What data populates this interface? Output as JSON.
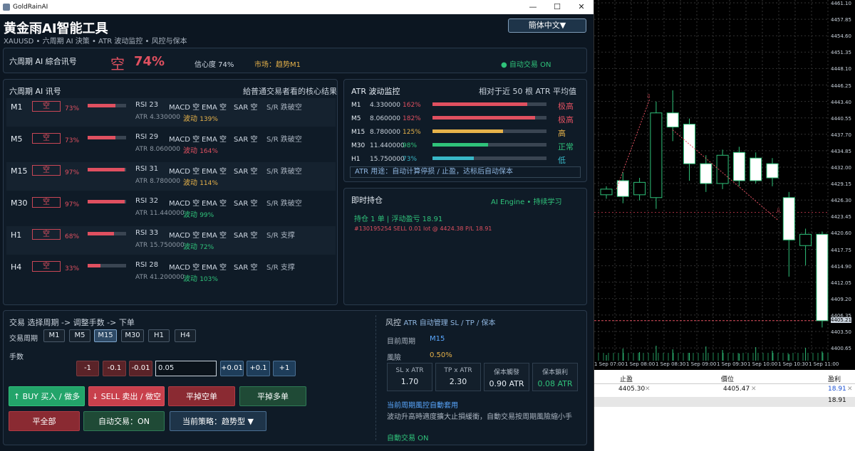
{
  "window": {
    "title": "GoldRainAI",
    "controls": [
      "—",
      "☐",
      "✕"
    ]
  },
  "app": {
    "title": "黄金雨AI智能工具",
    "subtitle": "XAUUSD • 六周期 AI 決策 • ATR 波动监控 • 风控与保本",
    "lang": "簡体中文▼"
  },
  "signal": {
    "label": "六周期 AI 綜合讯号",
    "direction": "空",
    "percent": "74%",
    "confidence": "信心度 74%",
    "market": "市场：趋势M1",
    "auto": "● 自动交易 ON"
  },
  "periods": {
    "title": "六周期 AI 讯号",
    "subtitle": "給普通交易者看的核心结果",
    "rows": [
      {
        "p": "M1",
        "d": "空",
        "pct": "73%",
        "fill": 0.73,
        "rsi": "RSI 23",
        "macd": "MACD 空",
        "ema": "EMA 空",
        "sar": "SAR 空",
        "sr": "S/R 跌破空",
        "atr": "ATR 4.330000",
        "vol": "波动",
        "volp": "139%",
        "volc": "#e6b24a"
      },
      {
        "p": "M5",
        "d": "空",
        "pct": "73%",
        "fill": 0.73,
        "rsi": "RSI 29",
        "macd": "MACD 空",
        "ema": "EMA 空",
        "sar": "SAR 空",
        "sr": "S/R 跌破空",
        "atr": "ATR 8.060000",
        "vol": "波动",
        "volp": "164%",
        "volc": "#e05060"
      },
      {
        "p": "M15",
        "d": "空",
        "pct": "97%",
        "fill": 0.97,
        "rsi": "RSI 31",
        "macd": "MACD 空",
        "ema": "EMA 空",
        "sar": "SAR 空",
        "sr": "S/R 跌破空",
        "atr": "ATR 8.780000",
        "vol": "波动",
        "volp": "114%",
        "volc": "#e6b24a"
      },
      {
        "p": "M30",
        "d": "空",
        "pct": "97%",
        "fill": 0.97,
        "rsi": "RSI 32",
        "macd": "MACD 空",
        "ema": "EMA 空",
        "sar": "SAR 空",
        "sr": "S/R 跌破空",
        "atr": "ATR 11.440000",
        "vol": "波动",
        "volp": "99%",
        "volc": "#2fc27a"
      },
      {
        "p": "H1",
        "d": "空",
        "pct": "68%",
        "fill": 0.68,
        "rsi": "RSI 33",
        "macd": "MACD 空",
        "ema": "EMA 空",
        "sar": "SAR 空",
        "sr": "S/R 支撑",
        "atr": "ATR 15.750000",
        "vol": "波动",
        "volp": "72%",
        "volc": "#2fc27a"
      },
      {
        "p": "H4",
        "d": "空",
        "pct": "33%",
        "fill": 0.33,
        "rsi": "RSI 28",
        "macd": "MACD 空",
        "ema": "EMA 空",
        "sar": "SAR 空",
        "sr": "S/R 支撑",
        "atr": "ATR 41.200000",
        "vol": "波动",
        "volp": "103%",
        "volc": "#2fc27a"
      }
    ]
  },
  "atr": {
    "title": "ATR 波动监控",
    "subtitle": "相对于近 50 根 ATR 平均值",
    "note": "ATR 用途：自动计算停损 / 止盈，达标后自动保本",
    "rows": [
      {
        "p": "M1",
        "v": "4.330000",
        "r": "162%",
        "fill": 0.83,
        "c": "#e05060",
        "lvl": "极高"
      },
      {
        "p": "M5",
        "v": "8.060000",
        "r": "182%",
        "fill": 0.9,
        "c": "#e05060",
        "lvl": "极高"
      },
      {
        "p": "M15",
        "v": "8.780000",
        "r": "125%",
        "fill": 0.62,
        "c": "#e6b24a",
        "lvl": "高"
      },
      {
        "p": "M30",
        "v": "11.440000",
        "r": "98%",
        "fill": 0.49,
        "c": "#2fc27a",
        "lvl": "正常"
      },
      {
        "p": "H1",
        "v": "15.750000",
        "r": "73%",
        "fill": 0.36,
        "c": "#39b8c8",
        "lvl": "低"
      }
    ]
  },
  "position": {
    "title": "即时持仓",
    "engine": "AI Engine • 持续学习",
    "summary": "持仓 1 单 | 浮动盈亏 18.91",
    "detail": "#130195254  SELL  0.01 lot  @ 4424.38  P/L 18.91"
  },
  "trade": {
    "title": "交易  选择周期 -> 调整手数 -> 下单",
    "period_label": "交易周期",
    "periods": [
      "M1",
      "M5",
      "M15",
      "M30",
      "H1",
      "H4"
    ],
    "active": "M15",
    "lots_label": "手数",
    "lot_btns_minus": [
      "-1",
      "-0.1",
      "-0.01"
    ],
    "lot_value": "0.05",
    "lot_btns_plus": [
      "+0.01",
      "+0.1",
      "+1"
    ],
    "buy": "↑ BUY 买入 / 做多",
    "sell": "↓ SELL 卖出 / 做空",
    "close_short": "平掉空单",
    "close_long": "平掉多单",
    "close_all": "平全部",
    "auto": "自动交易：ON",
    "strategy": "当前策略：趋势型 ▼"
  },
  "risk": {
    "title": "风控",
    "title_sub": "ATR 自动管理 SL / TP / 保本",
    "period_label": "目前周期",
    "period": "M15",
    "risk_label": "風險",
    "risk": "0.50%",
    "boxes": [
      {
        "l": "SL x ATR",
        "v": "1.70"
      },
      {
        "l": "TP x ATR",
        "v": "2.30"
      },
      {
        "l": "保本觸發",
        "v": "0.90 ATR"
      },
      {
        "l": "保本鎖利",
        "v": "0.08 ATR"
      }
    ],
    "applied": "当前周期風控自動套用",
    "desc": "波动升高時適度擴大止損緩衝，自動交易按周期風險縮小手",
    "auto": "自動交易 ON"
  },
  "chart_data": {
    "type": "candlestick",
    "price_ticks": [
      "4461.10",
      "4457.85",
      "4454.60",
      "4451.35",
      "4448.10",
      "4446.25",
      "4443.40",
      "4440.55",
      "4437.70",
      "4434.85",
      "4432.00",
      "4429.15",
      "4426.30",
      "4423.45",
      "4420.60",
      "4417.75",
      "4414.90",
      "4412.05",
      "4409.20",
      "4406.35",
      "4403.50",
      "4400.65"
    ],
    "current_price": "4405.21",
    "time_ticks": [
      "1 Sep 07:00",
      "1 Sep 08:00",
      "1 Sep 08:30",
      "1 Sep 09:00",
      "1 Sep 09:30",
      "1 Sep 10:00",
      "1 Sep 10:30",
      "1 Sep 11:00"
    ],
    "candles": [
      {
        "o": 4427.5,
        "c": 4428.5,
        "h": 4429,
        "l": 4426.8
      },
      {
        "o": 4430.0,
        "c": 4427.2,
        "h": 4431.5,
        "l": 4426.0
      },
      {
        "o": 4427.5,
        "c": 4429.7,
        "h": 4430.5,
        "l": 4426.5
      },
      {
        "o": 4427.0,
        "c": 4442.0,
        "h": 4444.0,
        "l": 4425.0
      },
      {
        "o": 4442.0,
        "c": 4439.5,
        "h": 4446.0,
        "l": 4437.0
      },
      {
        "o": 4440.0,
        "c": 4433.0,
        "h": 4441.0,
        "l": 4430.0
      },
      {
        "o": 4433.0,
        "c": 4429.5,
        "h": 4434.5,
        "l": 4428.0
      },
      {
        "o": 4429.5,
        "c": 4434.5,
        "h": 4435.5,
        "l": 4428.5
      },
      {
        "o": 4435.0,
        "c": 4430.0,
        "h": 4436.0,
        "l": 4429.0
      },
      {
        "o": 4434.0,
        "c": 4430.0,
        "h": 4435.0,
        "l": 4429.5
      },
      {
        "o": 4433.0,
        "c": 4430.5,
        "h": 4434.0,
        "l": 4429.0
      },
      {
        "o": 4427.0,
        "c": 4419.5,
        "h": 4428.0,
        "l": 4413.0
      },
      {
        "o": 4418.5,
        "c": 4420.5,
        "h": 4421.5,
        "l": 4415.0
      },
      {
        "o": 4420.5,
        "c": 4405.2,
        "h": 4421.0,
        "l": 4404.0
      }
    ]
  },
  "bottom": {
    "col1_head": "止盈",
    "col1_val": "4405.30",
    "col2_head": "價位",
    "col2_val": "4405.47",
    "col3_head": "盈利",
    "col3_val": "18.91",
    "total": "18.91"
  }
}
